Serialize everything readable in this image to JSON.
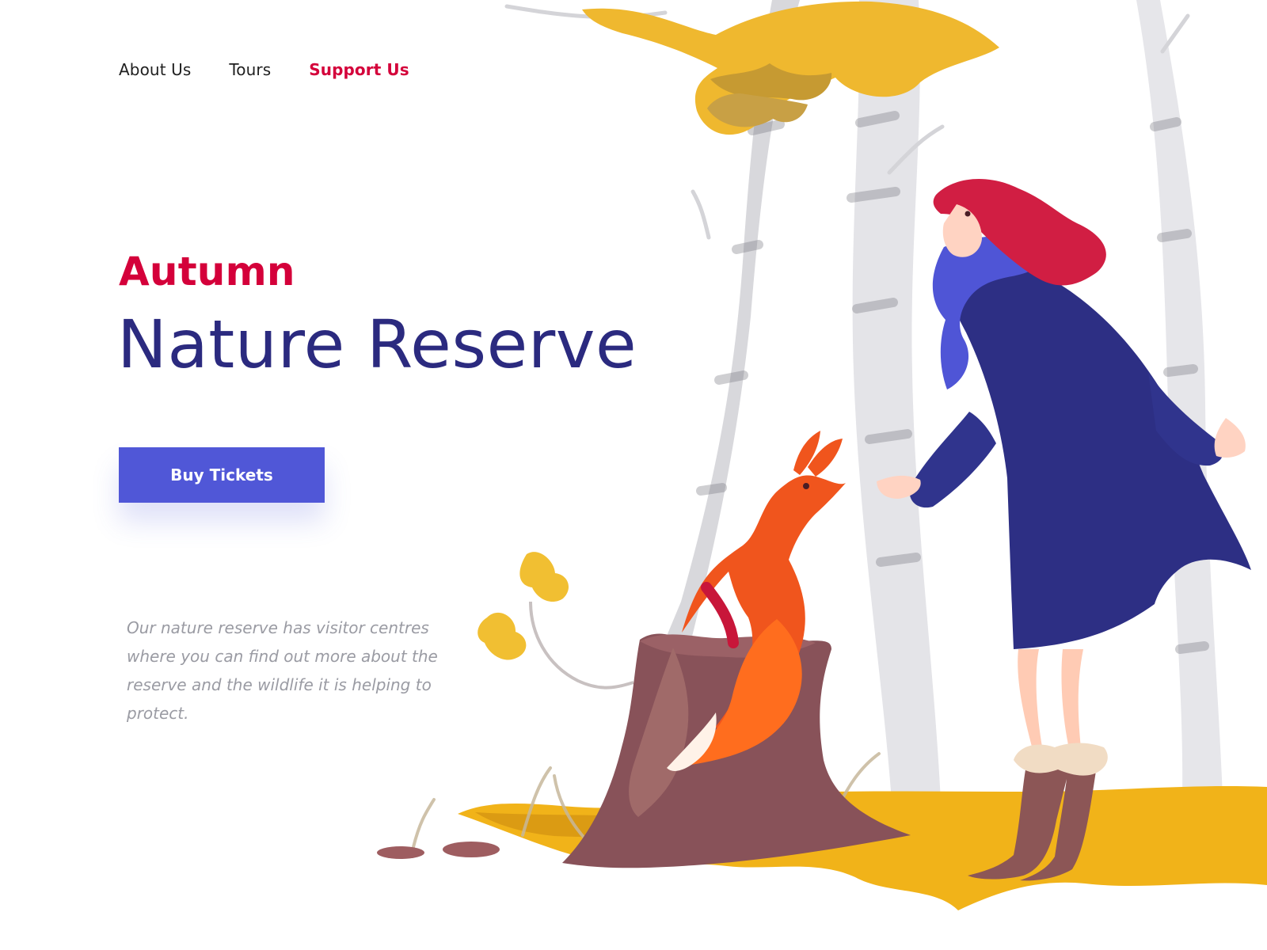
{
  "navigation": {
    "items": [
      {
        "label": "About Us"
      },
      {
        "label": "Tours"
      },
      {
        "label": "Support Us"
      }
    ]
  },
  "hero": {
    "label": "Autumn",
    "title": "Nature Reserve",
    "cta": "Buy Tickets",
    "description": "Our nature reserve has visitor centres where you can find out more about the reserve and the wildlife it is helping to protect."
  },
  "colors": {
    "accent_red": "#d4003a",
    "headline_navy": "#2b2a7f",
    "button_blue": "#5057d7",
    "description_gray": "#9a9ba3"
  }
}
